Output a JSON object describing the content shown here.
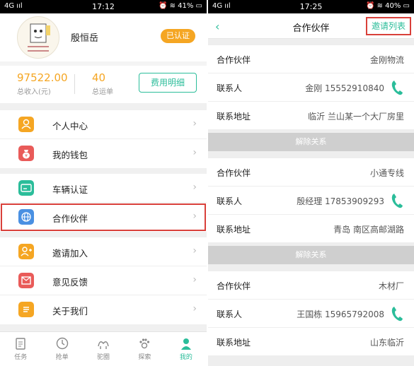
{
  "left": {
    "status": {
      "carrier": "4G ııl",
      "time": "17:12",
      "right": "⏰ ≋ 41% ▭"
    },
    "profile": {
      "name": "殷恒岳",
      "badge": "已认证"
    },
    "stats": {
      "income_value": "97522.00",
      "income_label": "总收入(元)",
      "orders_value": "40",
      "orders_label": "总运单",
      "detail_button": "费用明细"
    },
    "menu": [
      {
        "label": "个人中心",
        "color": "#f5a623"
      },
      {
        "label": "我的钱包",
        "color": "#e95b59"
      },
      {
        "label": "车辆认证",
        "color": "#2bbd9a"
      },
      {
        "label": "合作伙伴",
        "color": "#4a90e2"
      },
      {
        "label": "邀请加入",
        "color": "#f5a623"
      },
      {
        "label": "意见反馈",
        "color": "#e95b59"
      },
      {
        "label": "关于我们",
        "color": "#f5a623"
      }
    ],
    "tabs": [
      "任务",
      "抢单",
      "驼圈",
      "探索",
      "我的"
    ]
  },
  "right": {
    "status": {
      "carrier": "4G ııl",
      "time": "17:25",
      "right": "⏰ ≋ 40% ▭"
    },
    "nav": {
      "title": "合作伙伴",
      "invite_list": "邀请列表"
    },
    "labels": {
      "partner": "合作伙伴",
      "contact": "联系人",
      "address": "联系地址",
      "release": "解除关系"
    },
    "partners": [
      {
        "name": "金刚物流",
        "contact": "金刚 15552910840",
        "address": "临沂 兰山某一个大厂房里"
      },
      {
        "name": "小通专线",
        "contact": "殷经理 17853909293",
        "address": "青岛 南区高邮湖路"
      },
      {
        "name": "木材厂",
        "contact": "王国栋 15965792008",
        "address": "山东临沂"
      }
    ]
  },
  "colors": {
    "accent": "#2bbd9a",
    "badge": "#f5a623",
    "highlight": "#d9403a"
  }
}
